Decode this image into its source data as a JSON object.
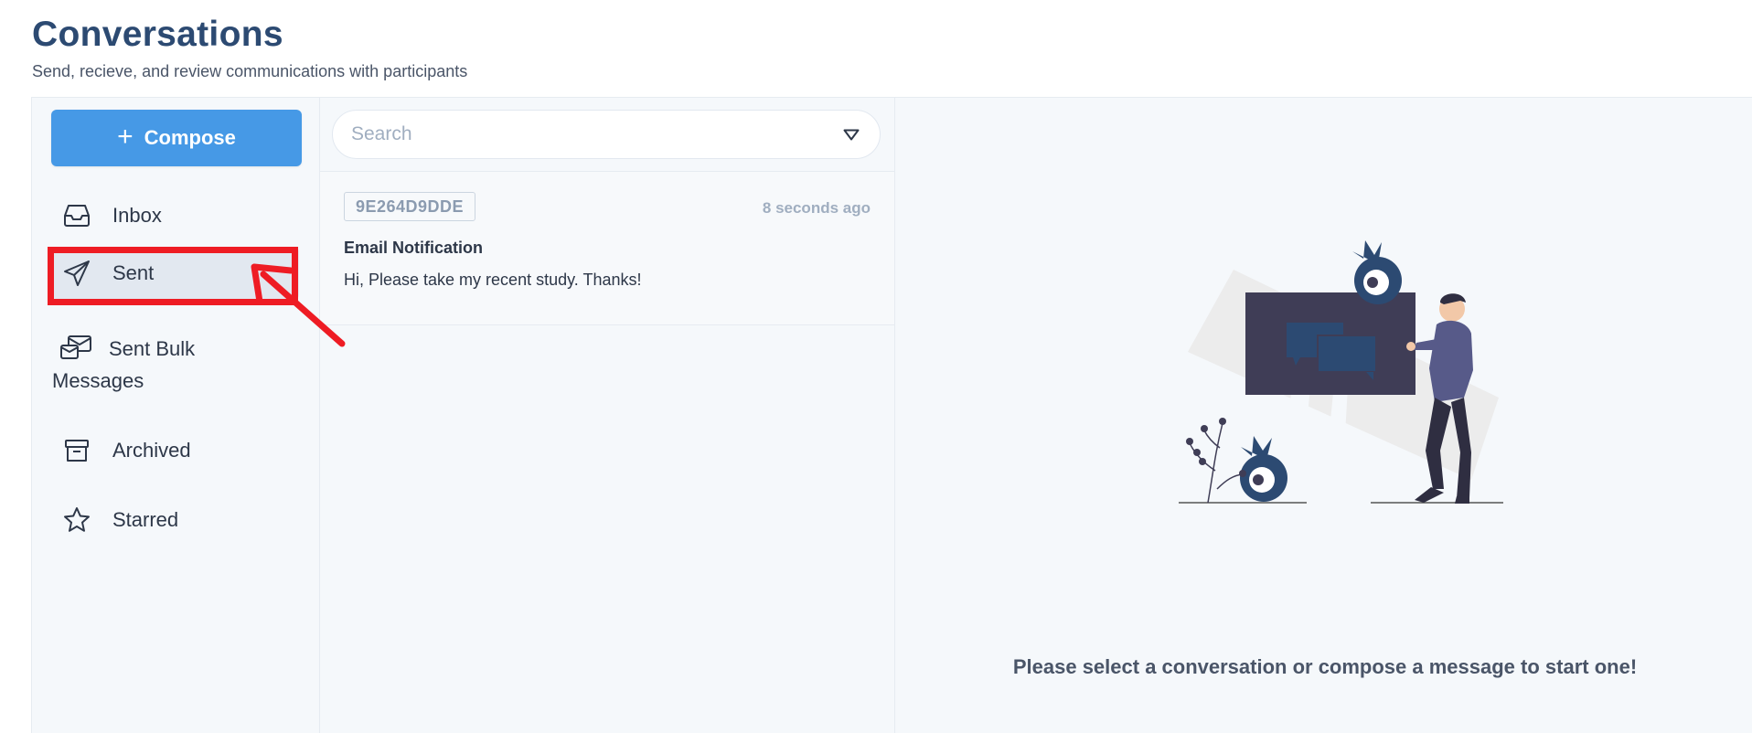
{
  "page": {
    "title": "Conversations",
    "subtitle": "Send, recieve, and review communications with participants"
  },
  "sidebar": {
    "compose_label": "Compose",
    "items": [
      {
        "label": "Inbox",
        "icon": "inbox-icon"
      },
      {
        "label": "Sent",
        "icon": "paper-plane-icon",
        "active": true
      },
      {
        "label": "Sent Bulk Messages",
        "label_line1": "Sent Bulk",
        "label_line2": "Messages",
        "icon": "bulk-mail-icon"
      },
      {
        "label": "Archived",
        "icon": "archive-box-icon"
      },
      {
        "label": "Starred",
        "icon": "star-icon"
      }
    ]
  },
  "search": {
    "placeholder": "Search",
    "value": ""
  },
  "conversations": [
    {
      "id": "9E264D9DDE",
      "time": "8 seconds ago",
      "subject": "Email Notification",
      "preview": "Hi, Please take my recent study. Thanks!"
    }
  ],
  "detail": {
    "empty_message": "Please select a conversation or compose a message to start one!"
  },
  "colors": {
    "title": "#2c4a72",
    "compose": "#4699e6",
    "annotation": "#ee1c24",
    "panel_bg": "#f5f8fb"
  }
}
